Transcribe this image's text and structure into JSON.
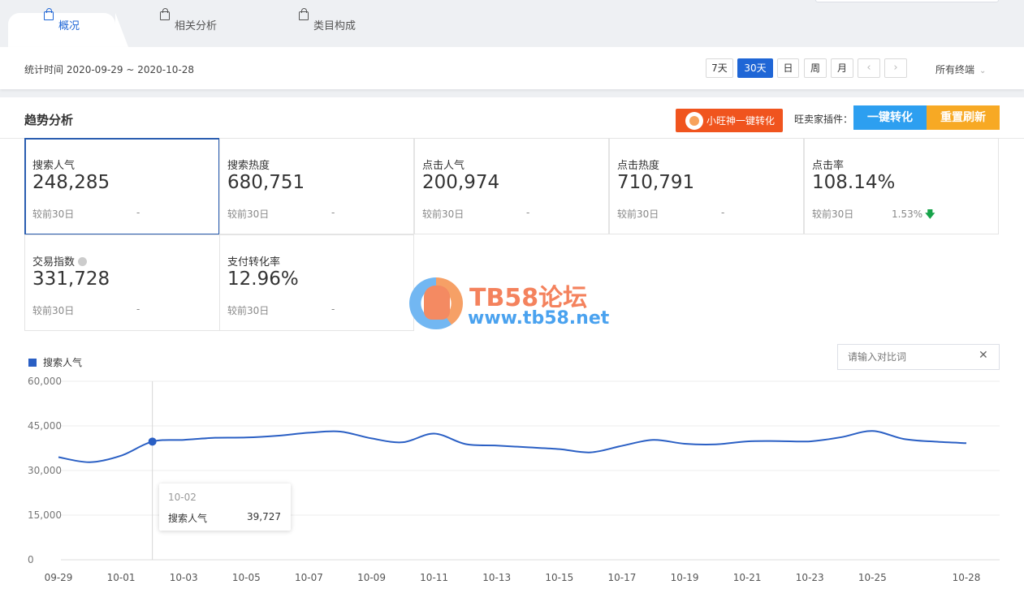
{
  "tabs": [
    {
      "label": "概况",
      "active": true
    },
    {
      "label": "相关分析",
      "active": false
    },
    {
      "label": "类目构成",
      "active": false
    }
  ],
  "date_bar": {
    "stat_time": "统计时间 2020-09-29 ~ 2020-10-28",
    "periods": [
      "7天",
      "30天",
      "日",
      "周",
      "月"
    ],
    "selected_period": "30天",
    "prev_icon": "chevron-left-icon",
    "next_icon": "chevron-right-icon",
    "terminal": "所有终端"
  },
  "panel": {
    "title": "趋势分析",
    "xiaowang_button": "小旺神一键转化",
    "plugin_label": "旺卖家插件：",
    "convert_button": "一键转化",
    "refresh_button": "重置刷新"
  },
  "metrics": [
    {
      "label": "搜索人气",
      "value": "248,285",
      "compare": "较前30日",
      "delta": "-",
      "selected": true
    },
    {
      "label": "搜索热度",
      "value": "680,751",
      "compare": "较前30日",
      "delta": "-"
    },
    {
      "label": "点击人气",
      "value": "200,974",
      "compare": "较前30日",
      "delta": "-"
    },
    {
      "label": "点击热度",
      "value": "710,791",
      "compare": "较前30日",
      "delta": "-"
    },
    {
      "label": "点击率",
      "value": "108.14%",
      "compare": "较前30日",
      "delta": "1.53%",
      "trend": "down"
    },
    {
      "label": "交易指数",
      "value": "331,728",
      "compare": "较前30日",
      "delta": "-"
    },
    {
      "label": "支付转化率",
      "value": "12.96%",
      "compare": "较前30日",
      "delta": "-"
    }
  ],
  "watermark": {
    "title": "TB58论坛",
    "url": "www.tb58.net"
  },
  "compare_input": {
    "placeholder": "请输入对比词"
  },
  "colors": {
    "accent": "#1f66d6",
    "line": "#2a5fc4",
    "orange": "#f0541e",
    "blue_btn": "#2d9ff0",
    "yellow_btn": "#f7a924"
  },
  "chart_data": {
    "type": "line",
    "legend": "搜索人气",
    "ylim": [
      0,
      60000
    ],
    "y_ticks": [
      "60,000",
      "45,000",
      "30,000",
      "15,000",
      "0"
    ],
    "x_ticks": [
      "09-29",
      "10-01",
      "10-03",
      "10-05",
      "10-07",
      "10-09",
      "10-11",
      "10-13",
      "10-15",
      "10-17",
      "10-19",
      "10-21",
      "10-23",
      "10-25",
      "10-28"
    ],
    "x": [
      "09-29",
      "09-30",
      "10-01",
      "10-02",
      "10-03",
      "10-04",
      "10-05",
      "10-06",
      "10-07",
      "10-08",
      "10-09",
      "10-10",
      "10-11",
      "10-12",
      "10-13",
      "10-14",
      "10-15",
      "10-16",
      "10-17",
      "10-18",
      "10-19",
      "10-20",
      "10-21",
      "10-22",
      "10-23",
      "10-24",
      "10-25",
      "10-26",
      "10-27",
      "10-28"
    ],
    "series": [
      {
        "name": "搜索人气",
        "values": [
          34500,
          32800,
          35000,
          39727,
          40300,
          41000,
          41100,
          41700,
          42700,
          43100,
          40800,
          39500,
          42400,
          38900,
          38400,
          37800,
          37200,
          36100,
          38300,
          40300,
          39000,
          38800,
          39800,
          39900,
          39800,
          41200,
          43300,
          40600,
          39700,
          39200
        ]
      }
    ],
    "tooltip": {
      "date": "10-02",
      "name": "搜索人气",
      "value": "39,727"
    }
  }
}
